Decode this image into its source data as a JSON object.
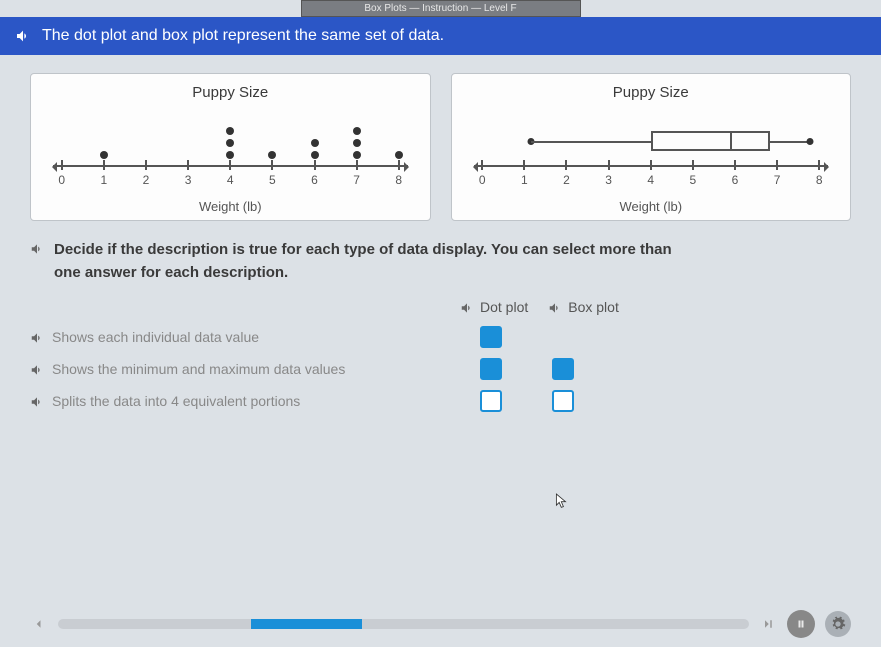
{
  "breadcrumb": "Box Plots — Instruction — Level F",
  "header": {
    "title": "The dot plot and box plot represent the same set of data."
  },
  "plots": {
    "dot": {
      "title": "Puppy Size",
      "axis_label": "Weight (lb)",
      "ticks": [
        "0",
        "1",
        "2",
        "3",
        "4",
        "5",
        "6",
        "7",
        "8"
      ]
    },
    "box": {
      "title": "Puppy Size",
      "axis_label": "Weight (lb)",
      "ticks": [
        "0",
        "1",
        "2",
        "3",
        "4",
        "5",
        "6",
        "7",
        "8"
      ]
    }
  },
  "question": {
    "line1": "Decide if the description is true for each type of data display. You can select more than",
    "line2": "one answer for each description."
  },
  "columns": {
    "dot": "Dot plot",
    "box": "Box plot"
  },
  "rows": {
    "r1": "Shows each individual data value",
    "r2": "Shows the minimum and maximum data values",
    "r3": "Splits the data into 4 equivalent portions"
  },
  "chart_data": [
    {
      "type": "dotplot",
      "title": "Puppy Size",
      "xlabel": "Weight (lb)",
      "xlim": [
        0,
        8
      ],
      "data": [
        1,
        4,
        4,
        4,
        5,
        6,
        6,
        7,
        7,
        7,
        8
      ]
    },
    {
      "type": "boxplot",
      "title": "Puppy Size",
      "xlabel": "Weight (lb)",
      "xlim": [
        0,
        8
      ],
      "min": 1,
      "q1": 4,
      "median": 6,
      "q3": 7,
      "max": 8
    }
  ],
  "answers": {
    "r1": {
      "dot": true,
      "box": false
    },
    "r2": {
      "dot": true,
      "box": true
    },
    "r3": {
      "dot": false,
      "box": false
    }
  }
}
